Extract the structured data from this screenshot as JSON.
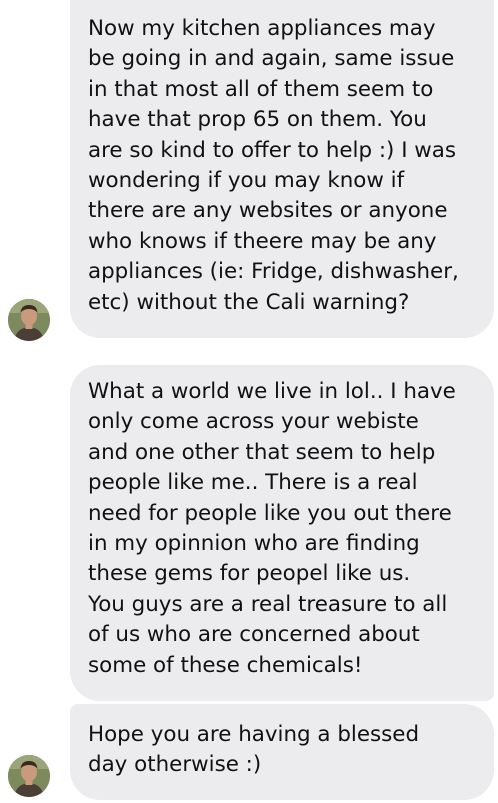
{
  "messages": [
    {
      "lines": [
        "Now my kitchen appliances may",
        "be going in and again, same issue",
        "in that most all of them seem to",
        "have that prop 65 on them.  You",
        "are so kind to offer to help :) I was",
        "wondering if you may know if",
        "there are any websites or anyone",
        "who knows if theere may be any",
        "appliances (ie: Fridge, dishwasher,",
        "etc) without the Cali warning?"
      ]
    },
    {
      "lines": [
        "What a world we live in lol..  I have",
        "only come across your webiste",
        "and one other that seem to help",
        "people like me..  There is a real",
        "need for people like you out there",
        "in my opinnion who are finding",
        "these gems for peopel like us.",
        "You guys are a real treasure to all",
        "of us who are concerned about",
        "some of these chemicals!"
      ]
    },
    {
      "lines": [
        "Hope you are having a blessed",
        "day otherwise :)"
      ]
    }
  ],
  "colors": {
    "bubble": "#ececee",
    "text": "#111111",
    "background": "#ffffff"
  },
  "icons": {
    "avatar": "sender-avatar-icon"
  }
}
